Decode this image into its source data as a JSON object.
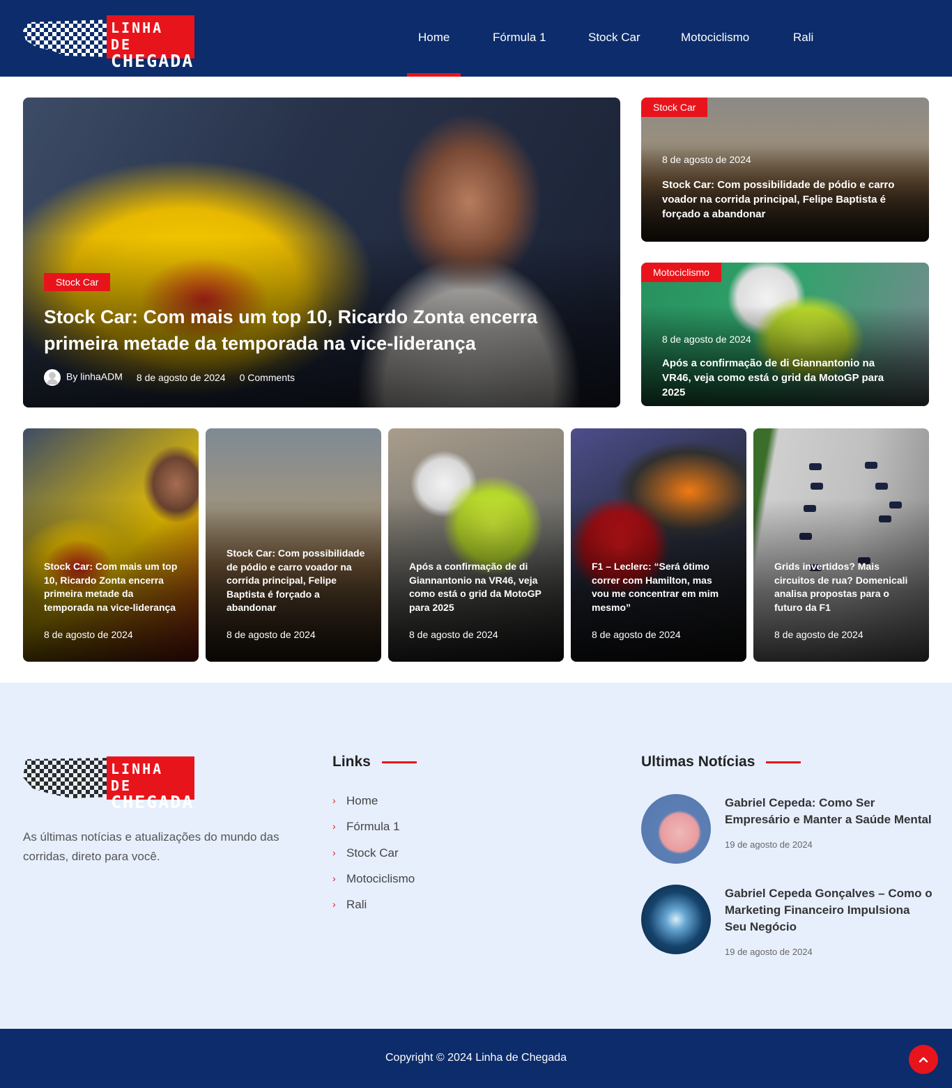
{
  "brand": {
    "logo_line1": "LINHA DE",
    "logo_line2": "CHEGADA",
    "accent": "#e8141c",
    "navy": "#0c2c6b"
  },
  "nav": {
    "items": [
      "Home",
      "Fórmula 1",
      "Stock Car",
      "Motociclismo",
      "Rali"
    ],
    "active": "Home"
  },
  "hero": {
    "category": "Stock Car",
    "title": "Stock Car: Com mais um top 10, Ricardo Zonta encerra primeira metade da temporada na vice-liderança",
    "author": "By linhaADM",
    "date": "8 de agosto de 2024",
    "comments": "0 Comments"
  },
  "side": [
    {
      "category": "Stock Car",
      "date": "8 de agosto de 2024",
      "title": "Stock Car: Com possibilidade de pódio e carro voador na corrida principal, Felipe Baptista é forçado a abandonar"
    },
    {
      "category": "Motociclismo",
      "date": "8 de agosto de 2024",
      "title": "Após a confirmação de di Giannantonio na VR46, veja como está o grid da MotoGP para 2025"
    }
  ],
  "grid": [
    {
      "title": "Stock Car: Com mais um top 10, Ricardo Zonta encerra primeira metade da temporada na vice-liderança",
      "date": "8 de agosto de 2024"
    },
    {
      "title": "Stock Car: Com possibilidade de pódio e carro voador na corrida principal, Felipe Baptista é forçado a abandonar",
      "date": "8 de agosto de 2024"
    },
    {
      "title": "Após a confirmação de di Giannantonio na VR46, veja como está o grid da MotoGP para 2025",
      "date": "8 de agosto de 2024"
    },
    {
      "title": "F1 – Leclerc: “Será ótimo correr com Hamilton, mas vou me concentrar em mim mesmo”",
      "date": "8 de agosto de 2024"
    },
    {
      "title": "Grids invertidos? Mais circuitos de rua? Domenicali analisa propostas para o futuro da F1",
      "date": "8 de agosto de 2024"
    }
  ],
  "footer": {
    "description": "As últimas notícias e atualizações do mundo das corridas, direto para você.",
    "links_heading": "Links",
    "links": [
      "Home",
      "Fórmula 1",
      "Stock Car",
      "Motociclismo",
      "Rali"
    ],
    "news_heading": "Ultimas Notícias",
    "news": [
      {
        "title": "Gabriel Cepeda: Como Ser Empresário e Manter a Saúde Mental",
        "date": "19 de agosto de 2024"
      },
      {
        "title": "Gabriel Cepeda Gonçalves – Como o Marketing Financeiro Impulsiona Seu Negócio",
        "date": "19 de agosto de 2024"
      }
    ],
    "copyright": "Copyright © 2024 Linha de Chegada"
  },
  "icons": {
    "scroll_top": "chevron-up-icon",
    "list_bullet": "chevron-right-icon",
    "author": "user-avatar-icon"
  }
}
